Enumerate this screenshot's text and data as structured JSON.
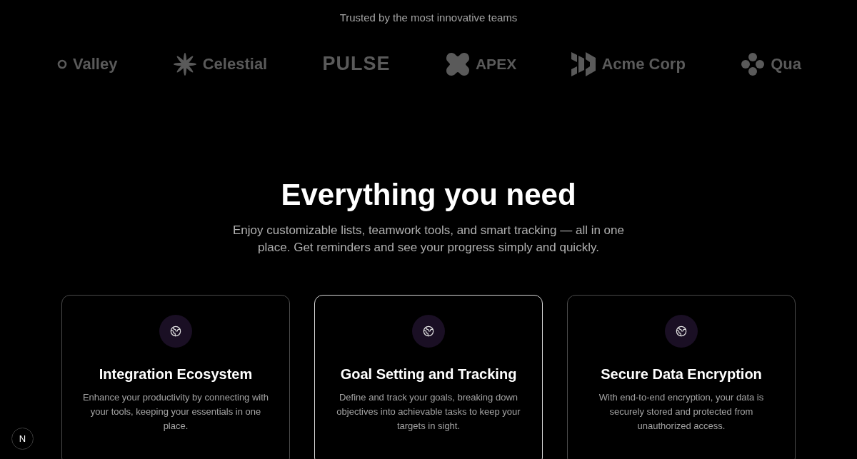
{
  "trusted_caption": "Trusted by the most innovative teams",
  "logos": [
    {
      "kind": "ring",
      "name": "Valley"
    },
    {
      "kind": "star",
      "name": "Celestial"
    },
    {
      "kind": "wordmark",
      "name": "PULSE"
    },
    {
      "kind": "blob",
      "name": "APEX"
    },
    {
      "kind": "chevrons",
      "name": "Acme Corp"
    },
    {
      "kind": "petals",
      "name": "Qua"
    }
  ],
  "section": {
    "title": "Everything you need",
    "subtitle": "Enjoy customizable lists, teamwork tools, and smart tracking — all in one place. Get reminders and see your progress simply and quickly."
  },
  "cards": [
    {
      "title": "Integration Ecosystem",
      "description": "Enhance your productivity by connecting with your tools, keeping your essentials in one place.",
      "highlighted": false
    },
    {
      "title": "Goal Setting and Tracking",
      "description": "Define and track your goals, breaking down objectives into achievable tasks to keep your targets in sight.",
      "highlighted": true
    },
    {
      "title": "Secure Data Encryption",
      "description": "With end-to-end encryption, your data is securely stored and protected from unauthorized access.",
      "highlighted": false
    }
  ],
  "dev_badge": "N"
}
